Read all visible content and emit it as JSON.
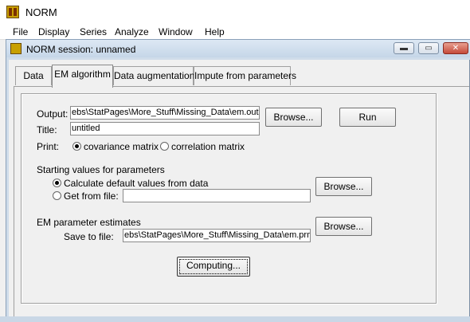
{
  "app": {
    "title": "NORM",
    "menu": [
      "File",
      "Display",
      "Series",
      "Analyze",
      "Window",
      "Help"
    ]
  },
  "session": {
    "title": "NORM session: unnamed",
    "window_buttons": {
      "minimize": "▬",
      "restore": "▭",
      "close": "✕"
    }
  },
  "tabs": [
    "Data",
    "EM algorithm",
    "Data augmentation",
    "Impute from parameters"
  ],
  "active_tab": "EM algorithm",
  "form": {
    "output_label": "Output:",
    "output_value": "ebs\\StatPages\\More_Stuff\\Missing_Data\\em.out",
    "browse_label": "Browse...",
    "run_label": "Run",
    "title_label": "Title:",
    "title_value": "untitled",
    "print_label": "Print:",
    "print_options": [
      "covariance matrix",
      "correlation matrix"
    ],
    "print_selected": "covariance matrix",
    "starting_header": "Starting values for parameters",
    "starting_options": [
      "Calculate default values from data",
      "Get from file:"
    ],
    "starting_selected": "Calculate default values from data",
    "get_from_file_value": "",
    "em_header": "EM parameter estimates",
    "save_label": "Save to file:",
    "save_value": "ebs\\StatPages\\More_Stuff\\Missing_Data\\em.prm",
    "computing_label": "Computing..."
  }
}
